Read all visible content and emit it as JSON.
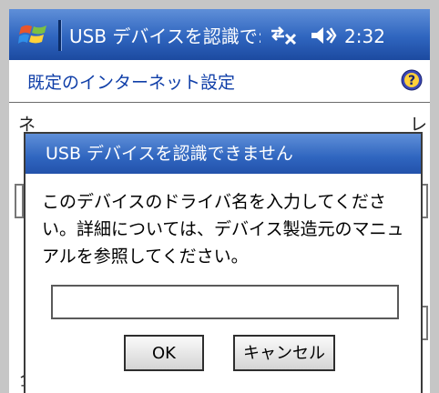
{
  "statusbar": {
    "title": "USB デバイスを認識で:",
    "time": "2:32",
    "icons": [
      "windows-start-icon",
      "connectivity-icon",
      "volume-icon"
    ]
  },
  "app": {
    "title": "既定のインターネット設定",
    "help_icon": "help-icon",
    "behind_fragments": {
      "top_left": "ネ",
      "top_right": "レ",
      "bottom_left": "全"
    }
  },
  "dialog": {
    "title": "USB デバイスを認識できません",
    "message": "このデバイスのドライバ名を入力してください。詳細については、デバイス製造元のマニュアルを参照してください。",
    "input_value": "",
    "ok_label": "OK",
    "cancel_label": "キャンセル"
  },
  "colors": {
    "titlebar_blue": "#2f65bf",
    "app_title_blue": "#0f3ea8",
    "dialog_border": "#3b3b3b"
  }
}
